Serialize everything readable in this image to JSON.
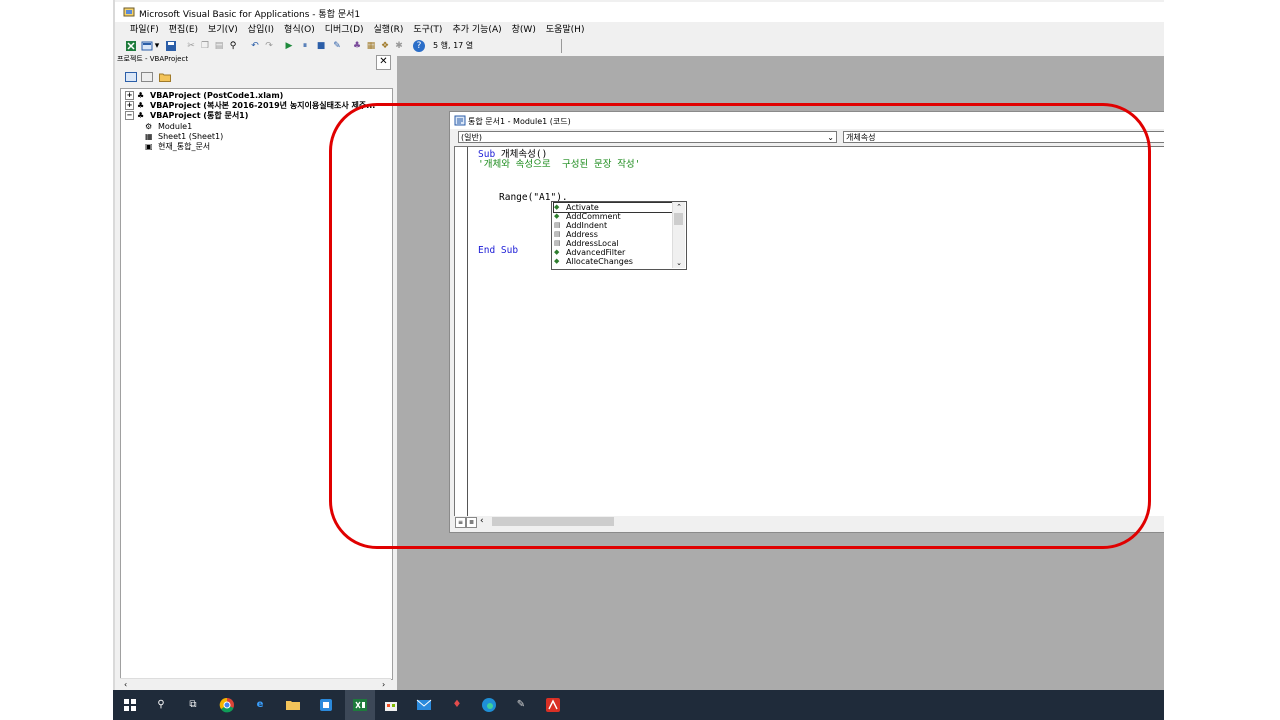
{
  "window": {
    "title": "Microsoft Visual Basic for Applications - 통합 문서1"
  },
  "menu": [
    "파일(F)",
    "편집(E)",
    "보기(V)",
    "삽입(I)",
    "형식(O)",
    "디버그(D)",
    "실행(R)",
    "도구(T)",
    "추가 기능(A)",
    "창(W)",
    "도움말(H)"
  ],
  "toolbar": {
    "cursor_position": "5 행, 17 열"
  },
  "project_explorer": {
    "title": "프로젝트 - VBAProject",
    "close": "✕",
    "tree": [
      {
        "label": "VBAProject (PostCode1.xlam)",
        "expander": "+",
        "icon": "vba-project-icon"
      },
      {
        "label": "VBAProject (복사본 2016-2019년 농지이용실태조사 제주...",
        "expander": "+",
        "icon": "vba-project-icon"
      },
      {
        "label": "VBAProject (통합 문서1)",
        "expander": "−",
        "icon": "vba-project-icon"
      },
      {
        "label": "Module1",
        "icon": "module-icon"
      },
      {
        "label": "Sheet1 (Sheet1)",
        "icon": "sheet-icon"
      },
      {
        "label": "현재_통합_문서",
        "icon": "workbook-icon"
      }
    ]
  },
  "code_window": {
    "title": "통합 문서1 - Module1 (코드)",
    "object_combo": "(일반)",
    "procedure_combo": "개체속성",
    "lines": {
      "sub_keyword": "Sub",
      "sub_name": " 개체속성()",
      "comment": "'개체와 속성으로  구성된 문장 작성'",
      "range_stmt": "Range(\"A1\").",
      "end_sub": "End Sub"
    },
    "autocomplete": [
      {
        "label": "Activate",
        "kind": "method"
      },
      {
        "label": "AddComment",
        "kind": "method"
      },
      {
        "label": "AddIndent",
        "kind": "property"
      },
      {
        "label": "Address",
        "kind": "property"
      },
      {
        "label": "AddressLocal",
        "kind": "property"
      },
      {
        "label": "AdvancedFilter",
        "kind": "method"
      },
      {
        "label": "AllocateChanges",
        "kind": "method"
      }
    ]
  },
  "taskbar": {
    "apps": [
      "start-icon",
      "search-icon",
      "task-view-icon",
      "chrome-icon",
      "edge-legacy-icon",
      "file-explorer-icon",
      "app-icon",
      "excel-icon",
      "store-icon",
      "mail-icon",
      "app-icon",
      "edge-icon",
      "paint-icon",
      "acrobat-icon"
    ]
  },
  "colors": {
    "keyword": "#1b1bd6",
    "comment": "#1a8a1a",
    "highlight": "#e00000",
    "mdi_background": "#ababab",
    "taskbar": "#1f2b3a"
  }
}
